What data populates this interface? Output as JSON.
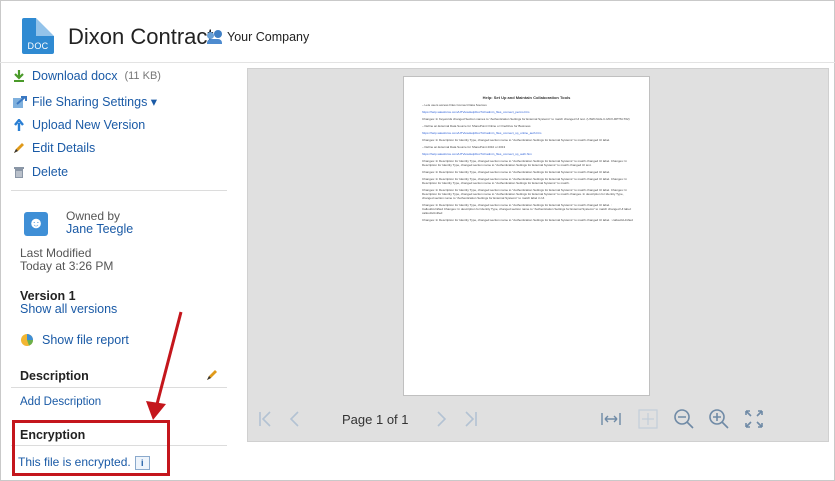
{
  "header": {
    "doc_icon_label": "DOC",
    "title": "Dixon Contract",
    "company": "Your Company",
    "company_icon": "people-icon"
  },
  "sidebar": {
    "actions": [
      {
        "label": "Download docx",
        "meta": "(11 KB)",
        "icon": "download-icon"
      },
      {
        "label": "File Sharing Settings ▾",
        "icon": "share-icon"
      },
      {
        "label": "Upload New Version",
        "icon": "upload-icon"
      },
      {
        "label": "Edit Details",
        "icon": "pencil-icon"
      },
      {
        "label": "Delete",
        "icon": "trash-icon"
      }
    ],
    "owner": {
      "label": "Owned by",
      "name": "Jane Teegle"
    },
    "last_modified": {
      "label": "Last Modified",
      "value": "Today at 3:26 PM"
    },
    "version": {
      "label": "Version 1",
      "link": "Show all versions"
    },
    "report": {
      "label": "Show file report",
      "icon": "report-icon"
    },
    "description": {
      "heading": "Description",
      "link": "Add Description",
      "edit_icon": "pencil-icon"
    },
    "encryption": {
      "heading": "Encryption",
      "text": "This file is encrypted.",
      "info": "i"
    }
  },
  "viewer": {
    "page_title": "Help: Set Up and Maintain Collaboration Tools",
    "page_lines": [
      {
        "text": "– Lets users access Files Connect Data Sources",
        "blue": false
      },
      {
        "text": "https://help.salesforce.com/HTViewHelpDoc?id=admin_files_connect_perms.htm",
        "blue": true
      },
      {
        "text": "Changes: In Keywords changed Section names to \"Authentication Settings for External Systems\" to match changed UI text. (UNW-NAG-C-MCX-RPTM-T02)",
        "blue": false
      },
      {
        "text": "– Define an External Data Source for SharePoint Online or OneDrive for Business",
        "blue": false
      },
      {
        "text": "https://help.salesforce.com/HTViewHelpDoc?id=admin_files_connect_sp_online_auth.htm",
        "blue": true
      },
      {
        "text": "Changes: In Description for Identity Type, changed section name to \"Authentication Settings for External Systems\" to match changed UI label.",
        "blue": false
      },
      {
        "text": "– Define an External Data Source for SharePoint 2010 or 2013",
        "blue": false
      },
      {
        "text": "https://help.salesforce.com/HTViewHelpDoc?id=admin_files_connect_sp_auth.htm",
        "blue": true
      },
      {
        "text": "Changes: In Description for Identity Type, changed section name to \"Authentication Settings for External Systems\" to match changed UI label. Changes: In Description for Identity Type, changed section name to \"Authentication Settings for External Systems\" to match changed UI text.",
        "blue": false
      },
      {
        "text": "Changes: In Description for Identity Type, changed section name to \"Authentication Settings for External Systems\" to match changed UI label.",
        "blue": false
      },
      {
        "text": "Changes: In Description for Identity Type, changed section name to \"Authentication Settings for External Systems\" to match changed UI label. Changes: In Description for Identity Type, changed section name to \"Authentication Settings for External Systems\" to match.",
        "blue": false
      },
      {
        "text": "Changes: In Description for Identity Type, changed section name to \"Authentication Settings for External Systems\" to match changed UI label. Changes: In Description for Identity Type, changed section name to \"Authentication Settings for External Systems\" to match changes. In description for Identity Type, changed section name to \"Authentication Settings for External Systems\" to match label in UI.",
        "blue": false
      },
      {
        "text": "Changes: In Description for Identity Type, changed section name to \"Authentication Settings for External Systems\" to match changed UI label. : CalloutIsUnified Changes: In description for Identity Type, changed section name to \"Authentication Settings for External Systems\" to match changed UI label: calloutIsUnified",
        "blue": false
      },
      {
        "text": "Changes: In Description for Identity Type, changed section name to \"Authentication Settings for External Systems\" to match changed UI label. : calloutIsUnified",
        "blue": false
      }
    ],
    "toolbar": {
      "page_label": "Page 1 of 1",
      "buttons": [
        "first-page-icon",
        "prev-page-icon",
        "next-page-icon",
        "last-page-icon",
        "fit-width-icon",
        "fit-page-icon",
        "zoom-out-icon",
        "zoom-in-icon",
        "fullscreen-icon"
      ]
    }
  },
  "colors": {
    "link": "#1a5aa6",
    "highlight": "#c4161c",
    "doc_icon": "#2f8ad2"
  }
}
